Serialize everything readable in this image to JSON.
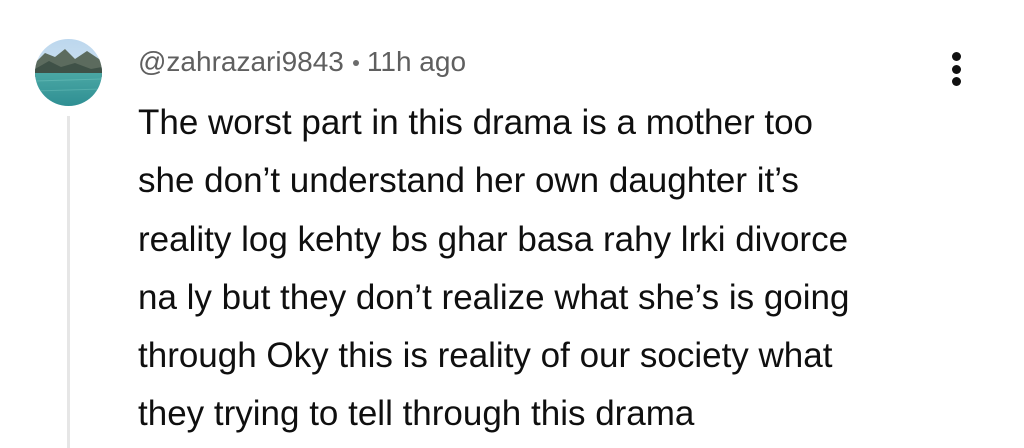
{
  "comment": {
    "author": "@zahrazari9843",
    "time_ago": "11h ago",
    "text": "The worst part in this drama is a mother too\nshe don’t understand her own daughter it’s\nreality log kehty bs ghar basa rahy lrki divorce\nna ly but they don’t realize what she’s is going\nthrough Oky this is reality of our society what\nthey trying to tell through this drama"
  },
  "icons": {
    "more": "more-vertical-icon",
    "avatar": "lake-landscape-avatar"
  }
}
